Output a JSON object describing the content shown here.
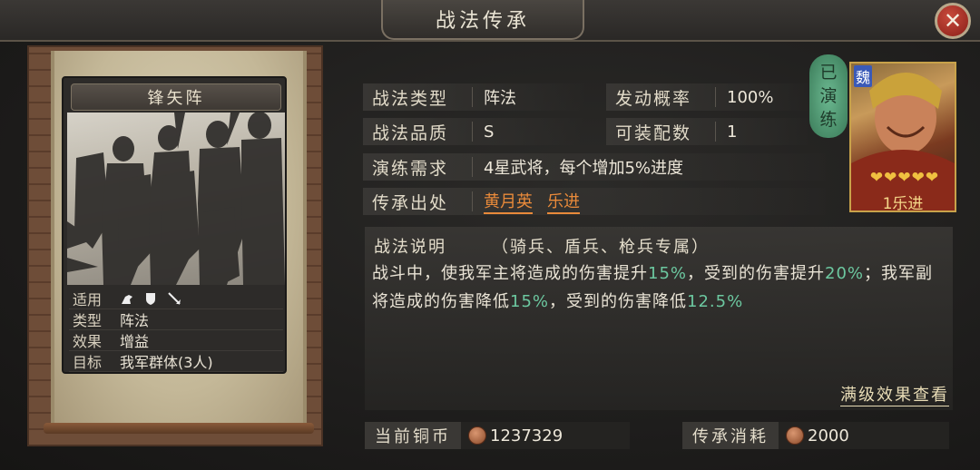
{
  "header": {
    "title": "战法传承",
    "close_icon": "close-icon"
  },
  "card": {
    "name": "锋矢阵",
    "rows": [
      {
        "key": "适用",
        "value": ""
      },
      {
        "key": "类型",
        "value": "阵法"
      },
      {
        "key": "效果",
        "value": "增益"
      },
      {
        "key": "目标",
        "value": "我军群体(3人)"
      }
    ],
    "applicable_icons": [
      "cavalry-icon",
      "shield-icon",
      "spear-icon"
    ]
  },
  "fields": {
    "type_label": "战法类型",
    "type_value": "阵法",
    "rate_label": "发动概率",
    "rate_value": "100%",
    "quality_label": "战法品质",
    "quality_value": "S",
    "equip_label": "可装配数",
    "equip_value": "1",
    "req_label": "演练需求",
    "req_value": "4星武将，每个增加5%进度",
    "source_label": "传承出处",
    "source_1": "黄月英",
    "source_2": "乐进"
  },
  "description": {
    "head": "战法说明",
    "sub": "（骑兵、盾兵、枪兵专属）",
    "t1": "战斗中，使我军主将造成的伤害提升",
    "v1": "15%",
    "t2": "，受到的伤害提升",
    "v2": "20%",
    "t3": "；我军副将造成的伤害降低",
    "v3": "15%",
    "t4": "，受到的伤害降低",
    "v4": "12.5%",
    "more": "满级效果查看"
  },
  "costs": {
    "coins_label": "当前铜币",
    "coins_value": "1237329",
    "cost_label": "传承消耗",
    "cost_value": "2000"
  },
  "portrait": {
    "learned": [
      "已",
      "演",
      "练"
    ],
    "faction": "魏",
    "stars": "❤❤❤❤❤",
    "name": "1乐进"
  }
}
